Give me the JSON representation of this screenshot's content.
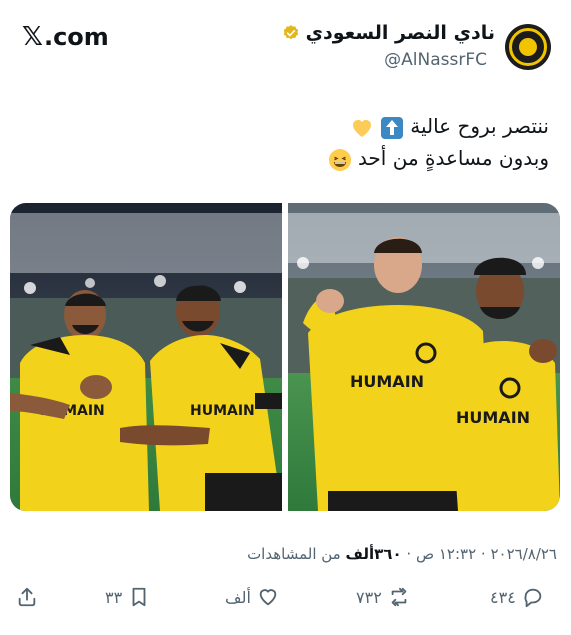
{
  "header": {
    "site": ".com",
    "display_name": "نادي النصر السعودي",
    "handle": "@AlNassrFC"
  },
  "tweet": {
    "line1": "ننتصر بروح عالية",
    "line2": "وبدون مساعدةٍ من أحد"
  },
  "meta": {
    "date": "٢٠٢٦/٨/٢٦",
    "time": "١٢:٣٢ ص",
    "sep": "·",
    "views_count": "٣٦٠ألف",
    "views_label": "من المشاهدات"
  },
  "actions": {
    "replies": "٤٣٤",
    "reposts": "٧٣٢",
    "likes": "ألف",
    "bookmarks": "٣٣"
  },
  "images": [
    {
      "jersey_text": "HUMAIN"
    },
    {
      "jersey_text": "HUMAIN"
    }
  ],
  "colors": {
    "jersey": "#f2d21a",
    "pitch": "#2f7a3b",
    "text_secondary": "#536471",
    "verified_gold": "#e2b719"
  }
}
